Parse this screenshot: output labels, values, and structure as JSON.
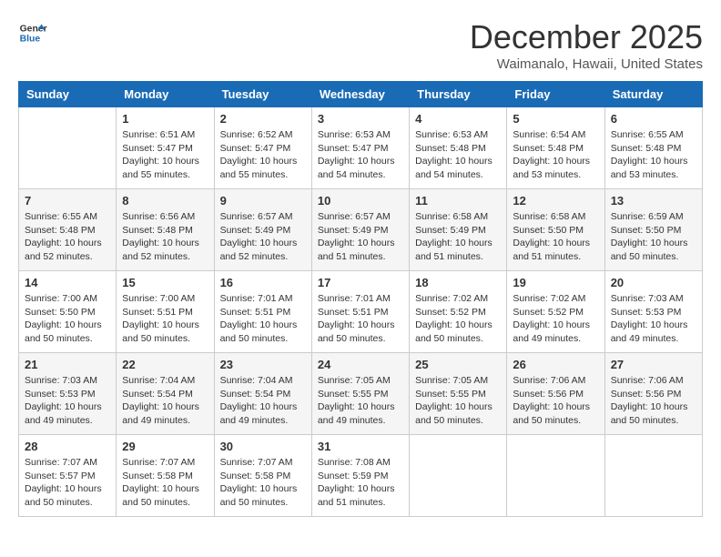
{
  "header": {
    "logo_general": "General",
    "logo_blue": "Blue",
    "month_title": "December 2025",
    "location": "Waimanalo, Hawaii, United States"
  },
  "weekdays": [
    "Sunday",
    "Monday",
    "Tuesday",
    "Wednesday",
    "Thursday",
    "Friday",
    "Saturday"
  ],
  "weeks": [
    [
      {
        "day": "",
        "sunrise": "",
        "sunset": "",
        "daylight": ""
      },
      {
        "day": "1",
        "sunrise": "Sunrise: 6:51 AM",
        "sunset": "Sunset: 5:47 PM",
        "daylight": "Daylight: 10 hours and 55 minutes."
      },
      {
        "day": "2",
        "sunrise": "Sunrise: 6:52 AM",
        "sunset": "Sunset: 5:47 PM",
        "daylight": "Daylight: 10 hours and 55 minutes."
      },
      {
        "day": "3",
        "sunrise": "Sunrise: 6:53 AM",
        "sunset": "Sunset: 5:47 PM",
        "daylight": "Daylight: 10 hours and 54 minutes."
      },
      {
        "day": "4",
        "sunrise": "Sunrise: 6:53 AM",
        "sunset": "Sunset: 5:48 PM",
        "daylight": "Daylight: 10 hours and 54 minutes."
      },
      {
        "day": "5",
        "sunrise": "Sunrise: 6:54 AM",
        "sunset": "Sunset: 5:48 PM",
        "daylight": "Daylight: 10 hours and 53 minutes."
      },
      {
        "day": "6",
        "sunrise": "Sunrise: 6:55 AM",
        "sunset": "Sunset: 5:48 PM",
        "daylight": "Daylight: 10 hours and 53 minutes."
      }
    ],
    [
      {
        "day": "7",
        "sunrise": "Sunrise: 6:55 AM",
        "sunset": "Sunset: 5:48 PM",
        "daylight": "Daylight: 10 hours and 52 minutes."
      },
      {
        "day": "8",
        "sunrise": "Sunrise: 6:56 AM",
        "sunset": "Sunset: 5:48 PM",
        "daylight": "Daylight: 10 hours and 52 minutes."
      },
      {
        "day": "9",
        "sunrise": "Sunrise: 6:57 AM",
        "sunset": "Sunset: 5:49 PM",
        "daylight": "Daylight: 10 hours and 52 minutes."
      },
      {
        "day": "10",
        "sunrise": "Sunrise: 6:57 AM",
        "sunset": "Sunset: 5:49 PM",
        "daylight": "Daylight: 10 hours and 51 minutes."
      },
      {
        "day": "11",
        "sunrise": "Sunrise: 6:58 AM",
        "sunset": "Sunset: 5:49 PM",
        "daylight": "Daylight: 10 hours and 51 minutes."
      },
      {
        "day": "12",
        "sunrise": "Sunrise: 6:58 AM",
        "sunset": "Sunset: 5:50 PM",
        "daylight": "Daylight: 10 hours and 51 minutes."
      },
      {
        "day": "13",
        "sunrise": "Sunrise: 6:59 AM",
        "sunset": "Sunset: 5:50 PM",
        "daylight": "Daylight: 10 hours and 50 minutes."
      }
    ],
    [
      {
        "day": "14",
        "sunrise": "Sunrise: 7:00 AM",
        "sunset": "Sunset: 5:50 PM",
        "daylight": "Daylight: 10 hours and 50 minutes."
      },
      {
        "day": "15",
        "sunrise": "Sunrise: 7:00 AM",
        "sunset": "Sunset: 5:51 PM",
        "daylight": "Daylight: 10 hours and 50 minutes."
      },
      {
        "day": "16",
        "sunrise": "Sunrise: 7:01 AM",
        "sunset": "Sunset: 5:51 PM",
        "daylight": "Daylight: 10 hours and 50 minutes."
      },
      {
        "day": "17",
        "sunrise": "Sunrise: 7:01 AM",
        "sunset": "Sunset: 5:51 PM",
        "daylight": "Daylight: 10 hours and 50 minutes."
      },
      {
        "day": "18",
        "sunrise": "Sunrise: 7:02 AM",
        "sunset": "Sunset: 5:52 PM",
        "daylight": "Daylight: 10 hours and 50 minutes."
      },
      {
        "day": "19",
        "sunrise": "Sunrise: 7:02 AM",
        "sunset": "Sunset: 5:52 PM",
        "daylight": "Daylight: 10 hours and 49 minutes."
      },
      {
        "day": "20",
        "sunrise": "Sunrise: 7:03 AM",
        "sunset": "Sunset: 5:53 PM",
        "daylight": "Daylight: 10 hours and 49 minutes."
      }
    ],
    [
      {
        "day": "21",
        "sunrise": "Sunrise: 7:03 AM",
        "sunset": "Sunset: 5:53 PM",
        "daylight": "Daylight: 10 hours and 49 minutes."
      },
      {
        "day": "22",
        "sunrise": "Sunrise: 7:04 AM",
        "sunset": "Sunset: 5:54 PM",
        "daylight": "Daylight: 10 hours and 49 minutes."
      },
      {
        "day": "23",
        "sunrise": "Sunrise: 7:04 AM",
        "sunset": "Sunset: 5:54 PM",
        "daylight": "Daylight: 10 hours and 49 minutes."
      },
      {
        "day": "24",
        "sunrise": "Sunrise: 7:05 AM",
        "sunset": "Sunset: 5:55 PM",
        "daylight": "Daylight: 10 hours and 49 minutes."
      },
      {
        "day": "25",
        "sunrise": "Sunrise: 7:05 AM",
        "sunset": "Sunset: 5:55 PM",
        "daylight": "Daylight: 10 hours and 50 minutes."
      },
      {
        "day": "26",
        "sunrise": "Sunrise: 7:06 AM",
        "sunset": "Sunset: 5:56 PM",
        "daylight": "Daylight: 10 hours and 50 minutes."
      },
      {
        "day": "27",
        "sunrise": "Sunrise: 7:06 AM",
        "sunset": "Sunset: 5:56 PM",
        "daylight": "Daylight: 10 hours and 50 minutes."
      }
    ],
    [
      {
        "day": "28",
        "sunrise": "Sunrise: 7:07 AM",
        "sunset": "Sunset: 5:57 PM",
        "daylight": "Daylight: 10 hours and 50 minutes."
      },
      {
        "day": "29",
        "sunrise": "Sunrise: 7:07 AM",
        "sunset": "Sunset: 5:58 PM",
        "daylight": "Daylight: 10 hours and 50 minutes."
      },
      {
        "day": "30",
        "sunrise": "Sunrise: 7:07 AM",
        "sunset": "Sunset: 5:58 PM",
        "daylight": "Daylight: 10 hours and 50 minutes."
      },
      {
        "day": "31",
        "sunrise": "Sunrise: 7:08 AM",
        "sunset": "Sunset: 5:59 PM",
        "daylight": "Daylight: 10 hours and 51 minutes."
      },
      {
        "day": "",
        "sunrise": "",
        "sunset": "",
        "daylight": ""
      },
      {
        "day": "",
        "sunrise": "",
        "sunset": "",
        "daylight": ""
      },
      {
        "day": "",
        "sunrise": "",
        "sunset": "",
        "daylight": ""
      }
    ]
  ]
}
